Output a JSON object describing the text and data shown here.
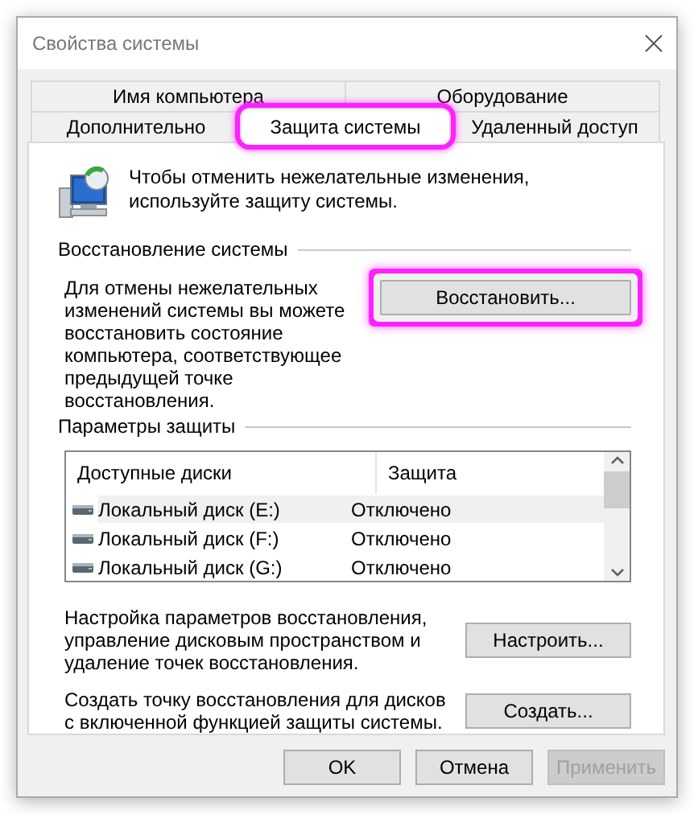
{
  "window": {
    "title": "Свойства системы"
  },
  "tabs": [
    [
      {
        "label": "Имя компьютера",
        "selected": false
      },
      {
        "label": "Оборудование",
        "selected": false
      }
    ],
    [
      {
        "label": "Дополнительно",
        "selected": false
      },
      {
        "label": "Защита системы",
        "selected": true,
        "highlighted": true
      },
      {
        "label": "Удаленный доступ",
        "selected": false
      }
    ]
  ],
  "intro": "Чтобы отменить нежелательные изменения, используйте защиту системы.",
  "restore_group": {
    "title": "Восстановление системы",
    "text": "Для отмены нежелательных изменений системы вы можете восстановить состояние компьютера, соответствующее предыдущей точке восстановления.",
    "button": {
      "label": "Восстановить...",
      "highlighted": true
    }
  },
  "protection_group": {
    "title": "Параметры защиты",
    "columns": [
      "Доступные диски",
      "Защита"
    ],
    "rows": [
      {
        "drive": "Локальный диск (E:)",
        "protection": "Отключено",
        "selected": true
      },
      {
        "drive": "Локальный диск (F:)",
        "protection": "Отключено",
        "selected": false
      },
      {
        "drive": "Локальный диск (G:)",
        "protection": "Отключено",
        "selected": false
      }
    ],
    "actions": [
      {
        "text": "Настройка параметров восстановления, управление дисковым пространством и удаление точек восстановления.",
        "button": "Настроить..."
      },
      {
        "text": "Создать точку восстановления для дисков с включенной функцией защиты системы.",
        "button": "Создать..."
      }
    ]
  },
  "buttons": [
    {
      "label": "OK",
      "disabled": false
    },
    {
      "label": "Отмена",
      "disabled": false
    },
    {
      "label": "Применить",
      "disabled": true
    }
  ]
}
